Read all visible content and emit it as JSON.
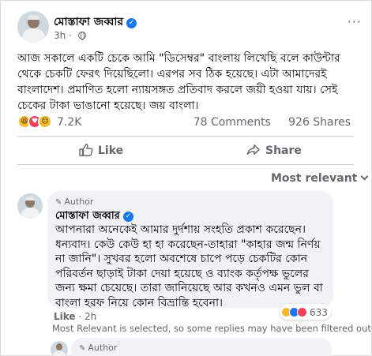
{
  "post": {
    "author": "মোস্তাফা জব্বার",
    "time": "3h",
    "more": "···",
    "text": "আজ সকালে একটি চেকে আমি \"ডিসেম্বর\" বাংলায় লিখেছি বলে কাউন্টার থেকে চেকটি ফেরৎ দিয়েছিলো।  এরপর সব ঠিক হয়েছে। এটা আমাদেরই বাংলাদেশ। প্রমাণিত হলো ন্যায়সঙ্গত প্রতিবাদ করলে জয়ী হওয়া যায়। সেই চেকের টাকা ভাঙানো হয়েছে। জয় বাংলা।",
    "reactions": {
      "icons": [
        "haha-icon",
        "love-icon",
        "sad-icon"
      ],
      "count": "7.2K"
    },
    "comments_count": "78 Comments",
    "shares_count": "926 Shares"
  },
  "actions": {
    "like": "Like",
    "share": "Share"
  },
  "sort": {
    "label": "Most relevant"
  },
  "comment": {
    "badge": "Author",
    "author": "মোস্তাফা জব্বার",
    "text": "আপনারা অনেকেই আমার দুর্দশায় সংহতি প্রকাশ করেছেন। ধন্যবাদ। কেউ কেউ হা হা করেছেন-তাহারা \"কাহার জন্ম নির্ণয় না জানি\"। সুখবর হলো অবশেষে চাপে পড়ে চেকটির কোন পরিবর্তন ছাড়াই টাকা দেয়া হয়েছে ও ব্যাংক কর্তৃপক্ষ ভুলের জন্য ক্ষমা চেয়েছে। তারা জানিয়েছে আর কখনও এমন ভুল বা বাংলা হরফ নিয়ে কোন বিভ্রান্তি হবেনা।",
    "reaction_count": "633",
    "like": "Like",
    "time": "2h",
    "filter_note": "Most Relevant is selected, so some replies may have been filtered out."
  },
  "reply": {
    "badge": "Author"
  },
  "colors": {
    "brand_blue": "#1877f2",
    "secondary_text": "#65676b",
    "bubble_bg": "#f0f2f5"
  }
}
